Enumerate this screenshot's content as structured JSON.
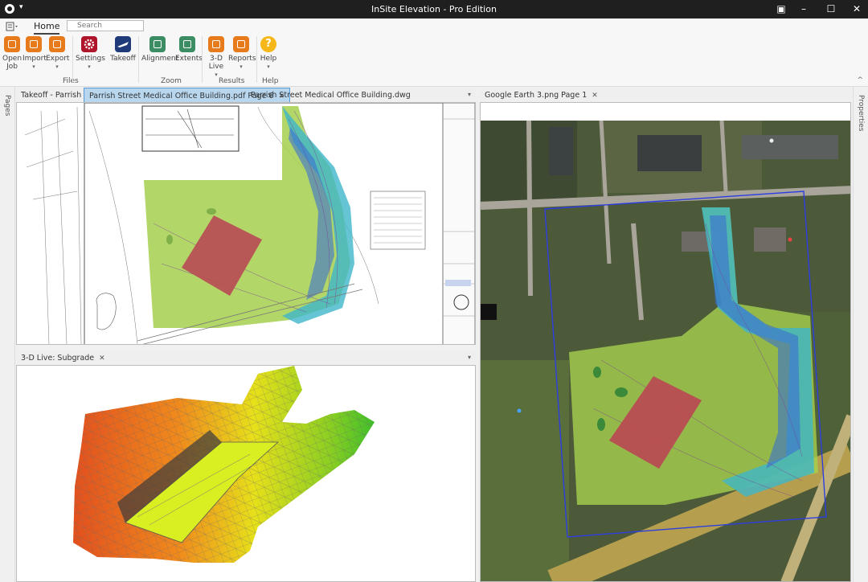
{
  "window": {
    "title": "InSite Elevation - Pro Edition"
  },
  "ribbon": {
    "tab": "Home",
    "search_placeholder": "Search",
    "buttons": {
      "open_job": [
        "Open",
        "Job"
      ],
      "import": "Import",
      "export": "Export",
      "settings": "Settings",
      "takeoff": "Takeoff",
      "alignment": "Alignment",
      "extents": "Extents",
      "live3d": [
        "3-D",
        "Live"
      ],
      "reports": "Reports",
      "help": "Help"
    },
    "groups": {
      "files": "Files",
      "zoom": "Zoom",
      "results": "Results",
      "help": "Help"
    }
  },
  "side": {
    "left": "Pages",
    "right": "Properties"
  },
  "tabs_left": [
    {
      "label": "Takeoff - Parrish Rd"
    },
    {
      "label": "Parrish Street Medical Office Building.pdf Page 6"
    },
    {
      "label": "Parrish Street Medical Office Building.dwg"
    }
  ],
  "tabs_right": [
    {
      "label": "Google Earth 3.png Page 1"
    }
  ],
  "tabs_bottom": [
    {
      "label": "3-D Live: Subgrade"
    }
  ],
  "colors": {
    "ribbon_orange": "#e77a1b",
    "tab_active": "#b8d7ef",
    "site_green": "#9ccc4a",
    "building": "#b84a54"
  },
  "icons": [
    "open-job-icon",
    "import-icon",
    "export-icon",
    "settings-icon",
    "takeoff-icon",
    "alignment-icon",
    "extents-icon",
    "3d-live-icon",
    "reports-icon",
    "help-icon"
  ]
}
